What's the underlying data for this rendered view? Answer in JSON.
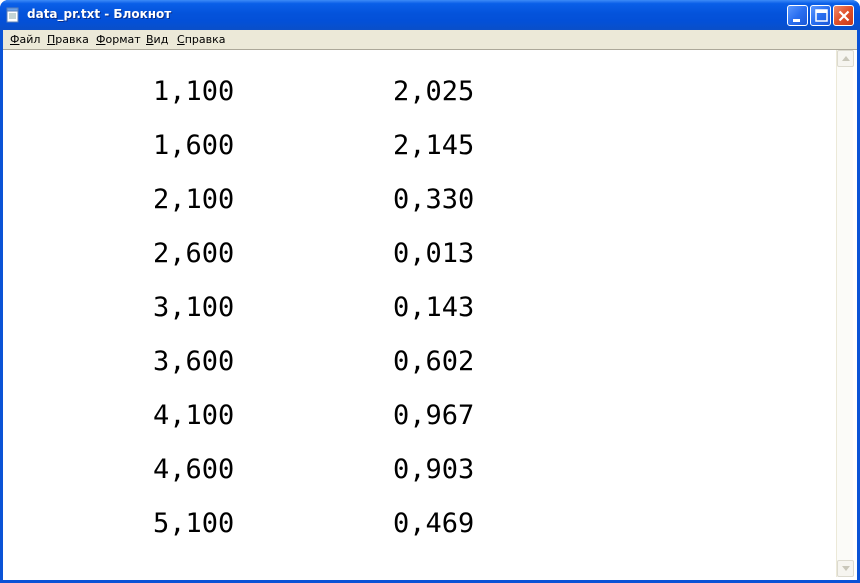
{
  "window": {
    "title": "data_pr.txt - Блокнот",
    "title_icon": "notepad-icon"
  },
  "title_buttons": {
    "minimize": "minimize-icon",
    "maximize": "maximize-icon",
    "close": "close-icon"
  },
  "menu": [
    {
      "accel": "Ф",
      "rest": "айл"
    },
    {
      "accel": "П",
      "rest": "равка"
    },
    {
      "accel": "Ф",
      "rest": "ормат"
    },
    {
      "accel": "В",
      "rest": "ид"
    },
    {
      "accel": "С",
      "rest": "правка"
    }
  ],
  "document": {
    "rows": [
      {
        "x": "1,100",
        "y": "2,025"
      },
      {
        "x": "1,600",
        "y": "2,145"
      },
      {
        "x": "2,100",
        "y": "0,330"
      },
      {
        "x": "2,600",
        "y": "0,013"
      },
      {
        "x": "3,100",
        "y": "0,143"
      },
      {
        "x": "3,600",
        "y": "0,602"
      },
      {
        "x": "4,100",
        "y": "0,967"
      },
      {
        "x": "4,600",
        "y": "0,903"
      },
      {
        "x": "5,100",
        "y": "0,469"
      }
    ]
  },
  "colors": {
    "titlebar": "#0453db",
    "menubar": "#ece9d8",
    "close_button": "#e0502a"
  }
}
